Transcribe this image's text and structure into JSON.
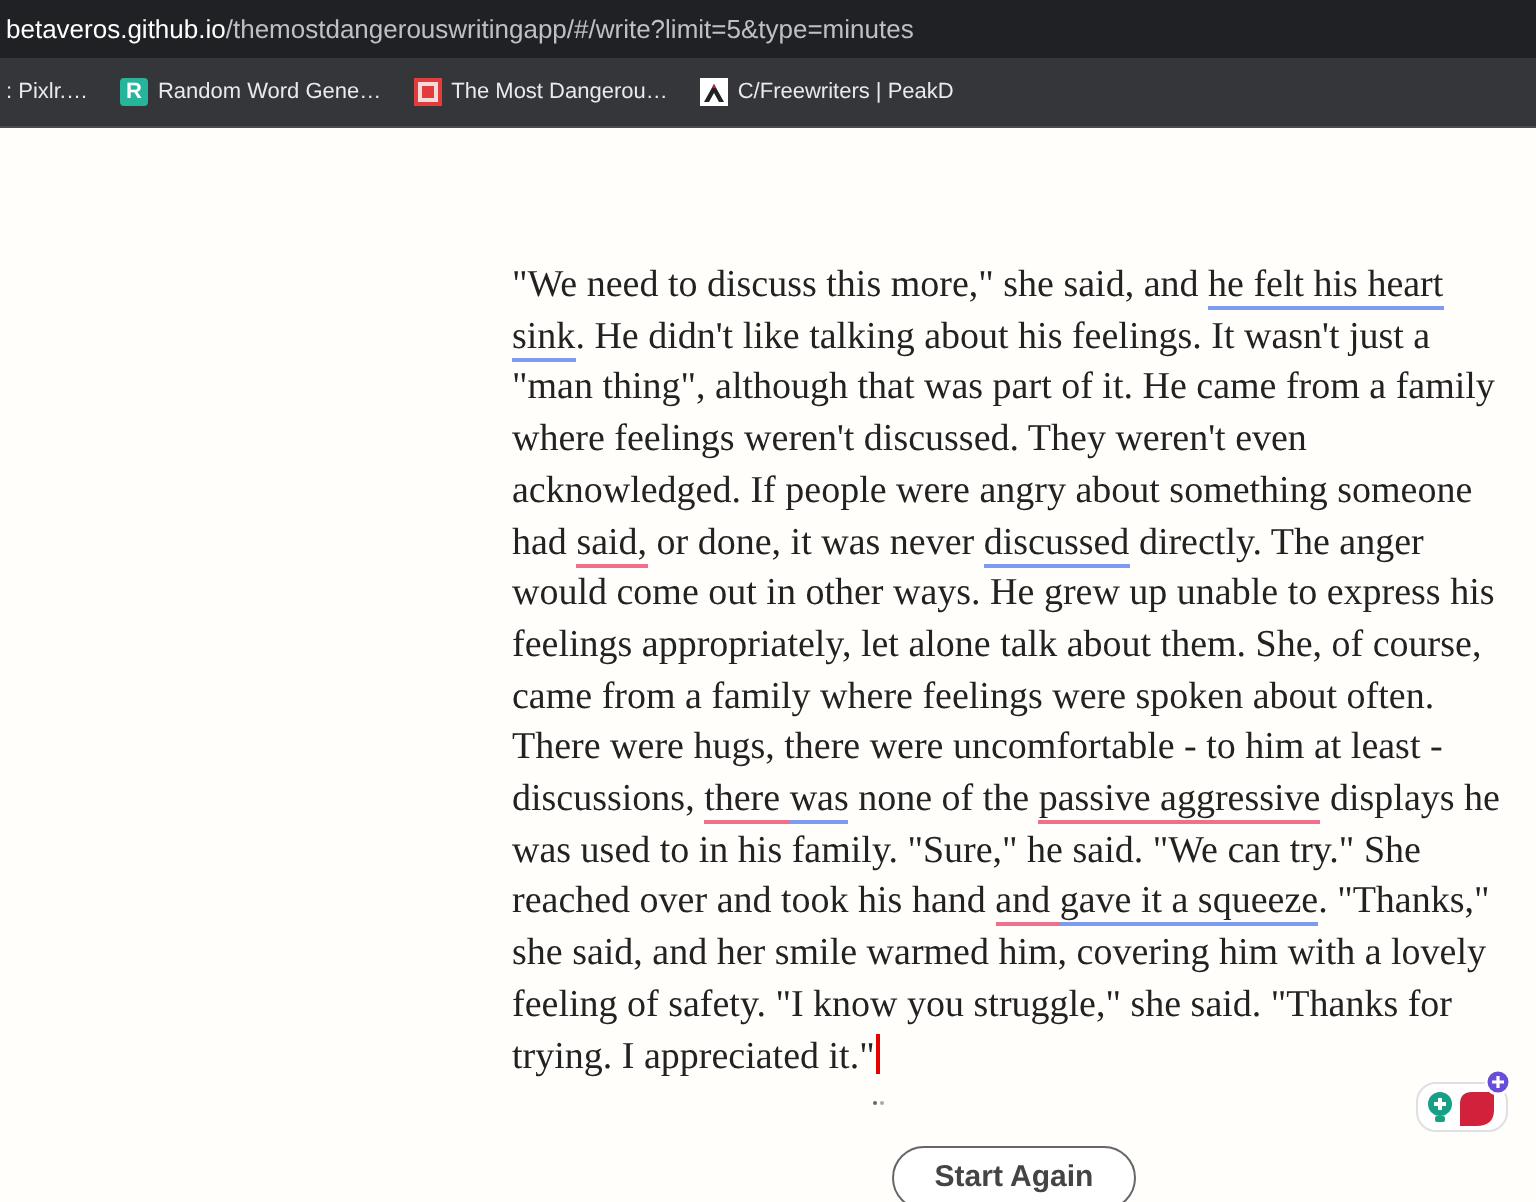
{
  "address_bar": {
    "url_host": "betaveros.github.io",
    "url_path": "/themostdangerouswritingapp/#/write?limit=5&type=minutes"
  },
  "bookmarks": [
    {
      "kind": "none",
      "label": ": Pixlr.…"
    },
    {
      "kind": "letter",
      "badge": "R",
      "label": "Random Word Gene…"
    },
    {
      "kind": "square",
      "label": "The Most Dangerou…"
    },
    {
      "kind": "peak",
      "label": "C/Freewriters | PeakD"
    }
  ],
  "editor": {
    "segments": [
      {
        "text": "\"We need to discuss this more,\" she said, and ",
        "kind": "plain"
      },
      {
        "text": "he felt his heart sink",
        "kind": "grammar"
      },
      {
        "text": ". He didn't like talking about his feelings. It wasn't just a \"man thing\", although that was part of it. He came from a family where feelings weren't discussed. They weren't even acknowledged. If people were angry about something someone had ",
        "kind": "plain"
      },
      {
        "text": "said,",
        "kind": "spelling"
      },
      {
        "text": " or done, it was never ",
        "kind": "plain"
      },
      {
        "text": "discussed",
        "kind": "grammar"
      },
      {
        "text": " directly. The anger would come out in other ways. He grew up unable to express his feelings appropriately, let alone talk about them. She, of course, came from a family where feelings were spoken about often. There were hugs, there were uncomfortable - to him at least - discussions, ",
        "kind": "plain"
      },
      {
        "text": "there ",
        "kind": "spelling"
      },
      {
        "text": "was",
        "kind": "grammar"
      },
      {
        "text": " none of the ",
        "kind": "plain"
      },
      {
        "text": "passive aggressive",
        "kind": "spelling"
      },
      {
        "text": " displays he was used to in his family. \"Sure,\" he said. \"We can try.\" She reached over and took his hand ",
        "kind": "plain"
      },
      {
        "text": "and ",
        "kind": "spelling"
      },
      {
        "text": "gave it a squeeze",
        "kind": "grammar"
      },
      {
        "text": ". \"Thanks,\" she said, and her smile warmed him, covering him with a lovely feeling of safety. \"I know you struggle,\" she said. \"Thanks for trying. I appreciated it.\"",
        "kind": "plain"
      }
    ]
  },
  "start_again_button": "Start Again"
}
